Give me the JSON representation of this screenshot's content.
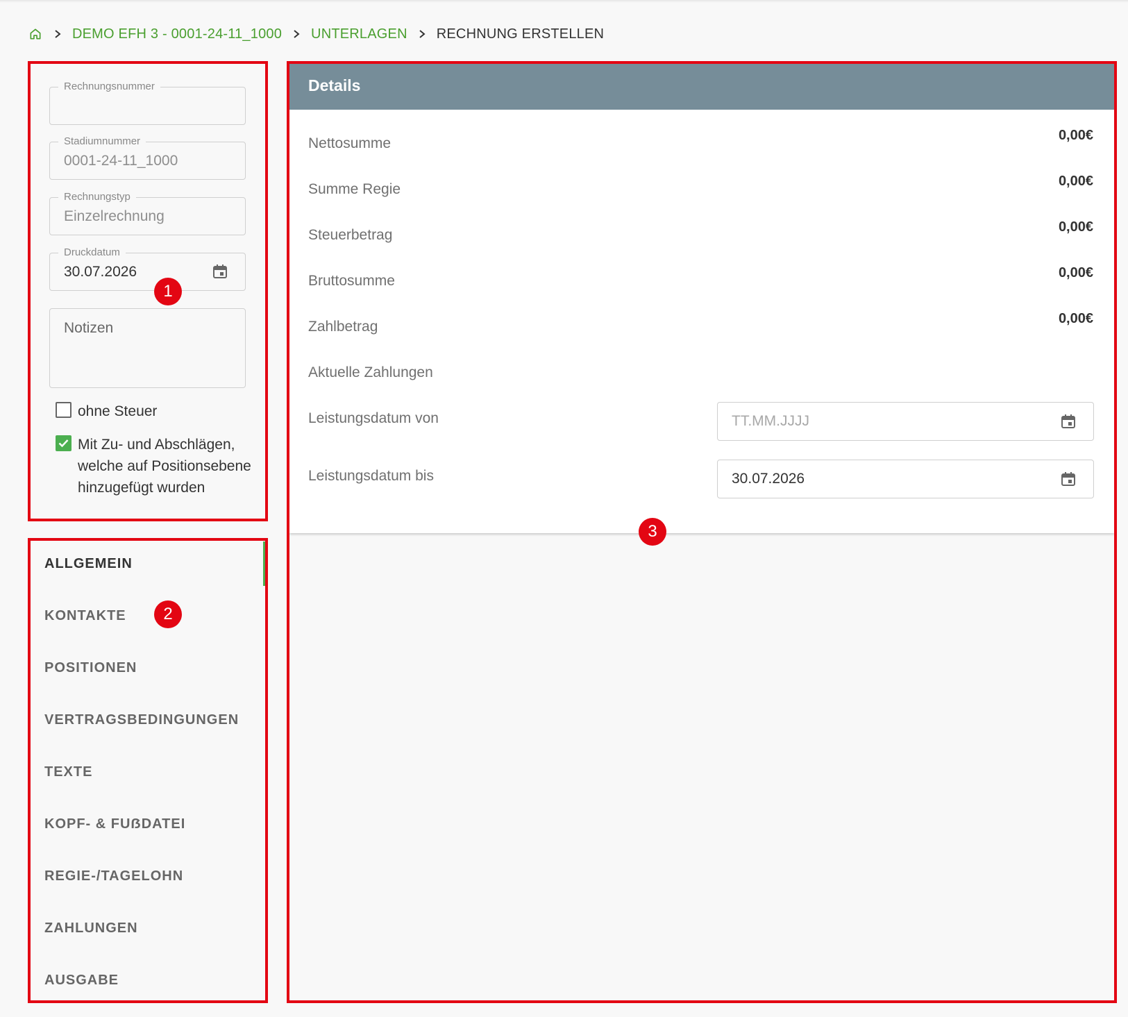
{
  "breadcrumb": {
    "items": [
      "DEMO EFH 3 - 0001-24-11_1000",
      "UNTERLAGEN"
    ],
    "current": "RECHNUNG ERSTELLEN"
  },
  "form": {
    "rechnungsnummer": {
      "label": "Rechnungsnummer",
      "value": ""
    },
    "stadiumnummer": {
      "label": "Stadiumnummer",
      "value": "0001-24-11_1000"
    },
    "rechnungstyp": {
      "label": "Rechnungstyp",
      "value": "Einzelrechnung"
    },
    "druckdatum": {
      "label": "Druckdatum",
      "value": "30.07.2026"
    },
    "notizen": {
      "placeholder": "Notizen"
    },
    "ohne_steuer": {
      "label": "ohne Steuer",
      "checked": false
    },
    "zuschlaege": {
      "label": "Mit Zu- und Abschlägen, welche auf Positionsebene hinzugefügt wurden",
      "checked": true
    }
  },
  "nav": {
    "items": [
      "ALLGEMEIN",
      "KONTAKTE",
      "POSITIONEN",
      "VERTRAGSBEDINGUNGEN",
      "TEXTE",
      "KOPF- & FUẞDATEI",
      "REGIE-/TAGELOHN",
      "ZAHLUNGEN",
      "AUSGABE"
    ],
    "active": "ALLGEMEIN"
  },
  "details": {
    "title": "Details",
    "rows": [
      {
        "label": "Nettosumme",
        "value": "0,00€"
      },
      {
        "label": "Summe Regie",
        "value": "0,00€"
      },
      {
        "label": "Steuerbetrag",
        "value": "0,00€"
      },
      {
        "label": "Bruttosumme",
        "value": "0,00€"
      },
      {
        "label": "Zahlbetrag",
        "value": "0,00€"
      },
      {
        "label": "Aktuelle Zahlungen",
        "value": ""
      }
    ],
    "leistung_von": {
      "label": "Leistungsdatum von",
      "value": "",
      "placeholder": "TT.MM.JJJJ"
    },
    "leistung_bis": {
      "label": "Leistungsdatum bis",
      "value": "30.07.2026"
    }
  },
  "annotations": [
    "1",
    "2",
    "3"
  ],
  "colors": {
    "accent": "#4a9f2f",
    "header": "#768d99",
    "annotation": "#e30613"
  },
  "icons": {
    "home": "home-icon",
    "separator": "chevron-right-icon",
    "date": "calendar-icon"
  }
}
